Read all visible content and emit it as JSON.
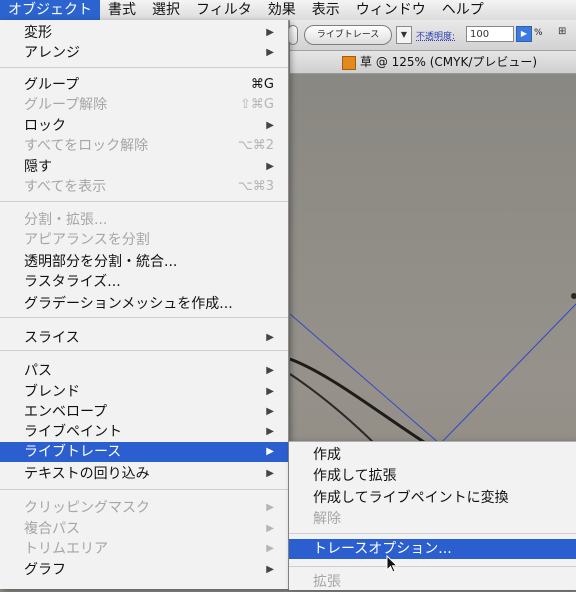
{
  "menubar": {
    "items": [
      "オブジェクト",
      "書式",
      "選択",
      "フィルタ",
      "効果",
      "表示",
      "ウィンドウ",
      "ヘルプ"
    ]
  },
  "toolbar": {
    "live_trace_button": "ライブトレース",
    "opacity_label": "不透明度:",
    "opacity_value": "100",
    "percent": "%"
  },
  "document": {
    "title": "草 @ 125% (CMYK/プレビュー)"
  },
  "object_menu": {
    "items": [
      {
        "label": "変形",
        "shortcut": "",
        "submenu": true,
        "disabled": false
      },
      {
        "label": "アレンジ",
        "shortcut": "",
        "submenu": true,
        "disabled": false
      },
      {
        "label": "グループ",
        "shortcut": "⌘G",
        "submenu": false,
        "disabled": false
      },
      {
        "label": "グループ解除",
        "shortcut": "⇧⌘G",
        "submenu": false,
        "disabled": true
      },
      {
        "label": "ロック",
        "shortcut": "",
        "submenu": true,
        "disabled": false
      },
      {
        "label": "すべてをロック解除",
        "shortcut": "⌥⌘2",
        "submenu": false,
        "disabled": true
      },
      {
        "label": "隠す",
        "shortcut": "",
        "submenu": true,
        "disabled": false
      },
      {
        "label": "すべてを表示",
        "shortcut": "⌥⌘3",
        "submenu": false,
        "disabled": true
      },
      {
        "label": "分割・拡張...",
        "shortcut": "",
        "submenu": false,
        "disabled": true
      },
      {
        "label": "アピアランスを分割",
        "shortcut": "",
        "submenu": false,
        "disabled": true
      },
      {
        "label": "透明部分を分割・統合...",
        "shortcut": "",
        "submenu": false,
        "disabled": false
      },
      {
        "label": "ラスタライズ...",
        "shortcut": "",
        "submenu": false,
        "disabled": false
      },
      {
        "label": "グラデーションメッシュを作成...",
        "shortcut": "",
        "submenu": false,
        "disabled": false
      },
      {
        "label": "スライス",
        "shortcut": "",
        "submenu": true,
        "disabled": false
      },
      {
        "label": "パス",
        "shortcut": "",
        "submenu": true,
        "disabled": false
      },
      {
        "label": "ブレンド",
        "shortcut": "",
        "submenu": true,
        "disabled": false
      },
      {
        "label": "エンベロープ",
        "shortcut": "",
        "submenu": true,
        "disabled": false
      },
      {
        "label": "ライブペイント",
        "shortcut": "",
        "submenu": true,
        "disabled": false
      },
      {
        "label": "ライブトレース",
        "shortcut": "",
        "submenu": true,
        "disabled": false,
        "highlighted": true
      },
      {
        "label": "テキストの回り込み",
        "shortcut": "",
        "submenu": true,
        "disabled": false
      },
      {
        "label": "クリッピングマスク",
        "shortcut": "",
        "submenu": true,
        "disabled": true
      },
      {
        "label": "複合パス",
        "shortcut": "",
        "submenu": true,
        "disabled": true
      },
      {
        "label": "トリムエリア",
        "shortcut": "",
        "submenu": true,
        "disabled": true
      },
      {
        "label": "グラフ",
        "shortcut": "",
        "submenu": true,
        "disabled": false
      }
    ]
  },
  "live_trace_submenu": {
    "items": [
      {
        "label": "作成",
        "disabled": false
      },
      {
        "label": "作成して拡張",
        "disabled": false
      },
      {
        "label": "作成してライブペイントに変換",
        "disabled": false
      },
      {
        "label": "解除",
        "disabled": true
      },
      {
        "label": "トレースオプション...",
        "disabled": false,
        "highlighted": true
      },
      {
        "label": "拡張",
        "disabled": true
      }
    ]
  },
  "icons": {
    "submenu_arrow": "chevron-right-icon",
    "doc": "document-icon",
    "cursor": "arrow-cursor-icon"
  },
  "colors": {
    "highlight": "#2b5fd0",
    "menu_bg": "#f2f2f2",
    "disabled_text": "#a6a6a6"
  }
}
